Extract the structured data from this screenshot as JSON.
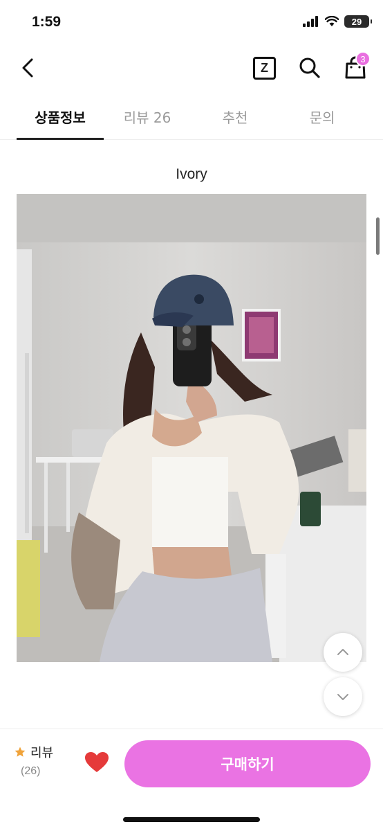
{
  "status_bar": {
    "time": "1:59",
    "battery": "29"
  },
  "nav": {
    "cart_badge": "3",
    "z_label": "Z"
  },
  "tabs": [
    {
      "label": "상품정보",
      "active": true
    },
    {
      "label": "리뷰 26",
      "active": false
    },
    {
      "label": "추천",
      "active": false
    },
    {
      "label": "문의",
      "active": false
    }
  ],
  "product": {
    "variant": "Ivory"
  },
  "bottom_bar": {
    "review_label": "리뷰",
    "review_count": "(26)",
    "buy_label": "구매하기"
  },
  "colors": {
    "accent": "#ea73e3",
    "heart": "#e53a3a",
    "star": "#f0a33a"
  }
}
